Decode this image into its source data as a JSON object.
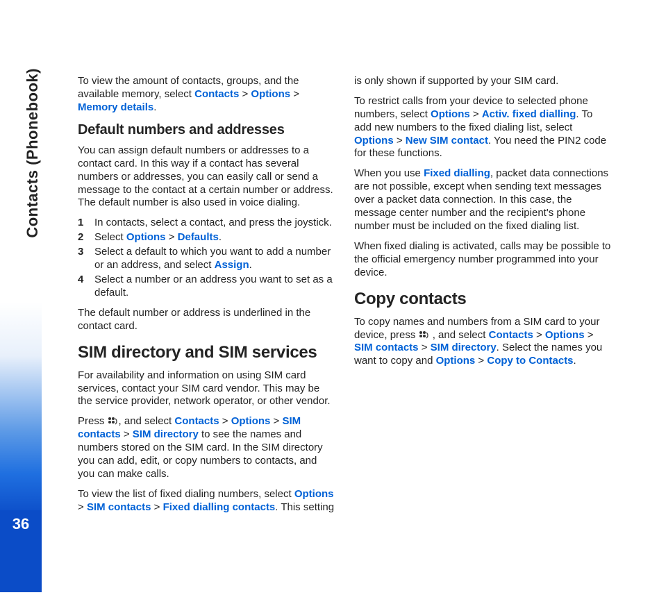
{
  "sideTab": "Contacts (Phonebook)",
  "pageNumber": "36",
  "col1": {
    "intro": {
      "pre": "To view the amount of contacts, groups, and the available memory, select ",
      "t1": "Contacts",
      "t2": "Options",
      "t3": "Memory details",
      "post": "."
    },
    "h2": "Default numbers and addresses",
    "p1": "You can assign default numbers or addresses to a contact card. In this way if a contact has several numbers or addresses, you can easily call or send a message to the contact at a certain number or address. The default number is also used in voice dialing.",
    "steps": {
      "n1": "1",
      "s1": "In contacts, select a contact, and press the joystick.",
      "n2": "2",
      "s2a": "Select ",
      "s2b": "Options",
      "s2c": "Defaults",
      "s2d": ".",
      "n3": "3",
      "s3a": "Select a default to which you want to add a number or an address, and select ",
      "s3b": "Assign",
      "s3c": ".",
      "n4": "4",
      "s4": "Select a number or an address you want to set as a default."
    },
    "p2": "The default number or address is underlined in the contact card.",
    "h1": "SIM directory and SIM services",
    "p3": "For availability and information on using SIM card services, contact your SIM card vendor. This may be the service provider, network operator, or other vendor.",
    "p4": {
      "a": "Press ",
      "b": ", and select ",
      "t1": "Contacts",
      "t2": "Options",
      "t3": "SIM contacts",
      "t4": "SIM directory",
      "c": " to see the names and numbers "
    }
  },
  "col2": {
    "p1": "stored on the SIM card. In the SIM directory you can add, edit, or copy numbers to contacts, and you can make calls.",
    "p2": {
      "a": "To view the list of fixed dialing numbers, select ",
      "t1": "Options",
      "t2": "SIM contacts",
      "t3": "Fixed dialling contacts",
      "b": ". This setting is only shown if supported by your SIM card."
    },
    "p3": {
      "a": "To restrict calls from your device to selected phone numbers, select ",
      "t1": "Options",
      "t2": "Activ. fixed dialling",
      "b": ". To add new numbers to the fixed dialing list, select ",
      "t3": "Options",
      "t4": "New SIM contact",
      "c": ". You need the PIN2 code for these functions."
    },
    "p4": {
      "a": "When you use ",
      "t1": "Fixed dialling",
      "b": ", packet data connections are not possible, except when sending text messages over a packet data connection. In this case, the message center number and the recipient's phone number must be included on the fixed dialing list."
    },
    "p5": "When fixed dialing is activated, calls may be possible to the official emergency number programmed into your device.",
    "h1": "Copy contacts",
    "p6": {
      "a": "To copy names and numbers from a SIM card to your device, press ",
      "b": " , and select ",
      "t1": "Contacts",
      "t2": "Options",
      "t3": "SIM contacts",
      "t4": "SIM directory",
      "c": ". Select the names you want to copy and ",
      "t5": "Options",
      "t6": "Copy to Contacts",
      "d": "."
    }
  },
  "gt": " > "
}
